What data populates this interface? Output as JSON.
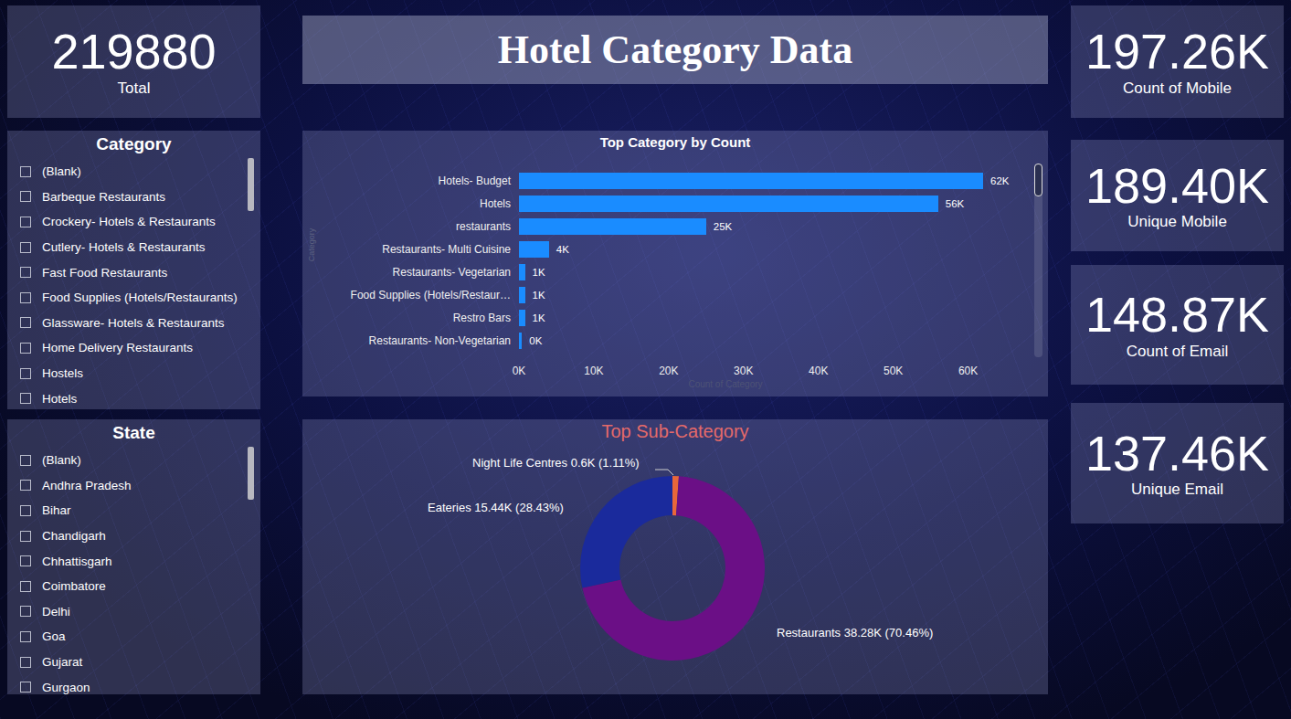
{
  "title": "Hotel Category Data",
  "total": {
    "value": "219880",
    "label": "Total"
  },
  "kpis": [
    {
      "value": "197.26K",
      "label": "Count of Mobile"
    },
    {
      "value": "189.40K",
      "label": "Unique Mobile"
    },
    {
      "value": "148.87K",
      "label": "Count of Email"
    },
    {
      "value": "137.46K",
      "label": "Unique Email"
    }
  ],
  "category_slicer": {
    "title": "Category",
    "items": [
      {
        "label": "(Blank)",
        "checked": false
      },
      {
        "label": "Barbeque Restaurants",
        "checked": false
      },
      {
        "label": "Crockery- Hotels & Restaurants",
        "checked": false
      },
      {
        "label": "Cutlery- Hotels & Restaurants",
        "checked": false
      },
      {
        "label": "Fast Food Restaurants",
        "checked": false
      },
      {
        "label": "Food Supplies (Hotels/Restaurants)",
        "checked": false
      },
      {
        "label": "Glassware- Hotels & Restaurants",
        "checked": false
      },
      {
        "label": "Home Delivery Restaurants",
        "checked": false
      },
      {
        "label": "Hostels",
        "checked": false
      },
      {
        "label": "Hotels",
        "checked": false
      }
    ]
  },
  "state_slicer": {
    "title": "State",
    "items": [
      {
        "label": "(Blank)",
        "checked": false
      },
      {
        "label": "Andhra Pradesh",
        "checked": false
      },
      {
        "label": "Bihar",
        "checked": false
      },
      {
        "label": "Chandigarh",
        "checked": false
      },
      {
        "label": "Chhattisgarh",
        "checked": false
      },
      {
        "label": "Coimbatore",
        "checked": false
      },
      {
        "label": "Delhi",
        "checked": false
      },
      {
        "label": "Goa",
        "checked": false
      },
      {
        "label": "Gujarat",
        "checked": false
      },
      {
        "label": "Gurgaon",
        "checked": false
      }
    ]
  },
  "bar_chart": {
    "title": "Top Category by Count",
    "y_axis_title": "Category",
    "x_axis_title": "Count of Category",
    "categories": [
      "Hotels- Budget",
      "Hotels",
      "restaurants",
      "Restaurants- Multi Cuisine",
      "Restaurants- Vegetarian",
      "Food Supplies (Hotels/Restaur…",
      "Restro Bars",
      "Restaurants- Non-Vegetarian"
    ],
    "values": [
      62000,
      56000,
      25000,
      4000,
      800,
      800,
      800,
      400
    ],
    "data_labels": [
      "62K",
      "56K",
      "25K",
      "4K",
      "1K",
      "1K",
      "1K",
      "0K"
    ],
    "ticks": [
      "0K",
      "10K",
      "20K",
      "30K",
      "40K",
      "50K",
      "60K"
    ],
    "tick_values": [
      0,
      10000,
      20000,
      30000,
      40000,
      50000,
      60000
    ]
  },
  "donut": {
    "title": "Top Sub-Category",
    "segments": [
      {
        "name": "Night Life Centres",
        "value": 600,
        "label": "Night Life Centres 0.6K (1.11%)",
        "color": "#e8673a"
      },
      {
        "name": "Restaurants",
        "value": 38280,
        "label": "Restaurants 38.28K (70.46%)",
        "color": "#6b0f86"
      },
      {
        "name": "Eateries",
        "value": 15440,
        "label": "Eateries 15.44K (28.43%)",
        "color": "#1a2a9c"
      }
    ]
  }
}
